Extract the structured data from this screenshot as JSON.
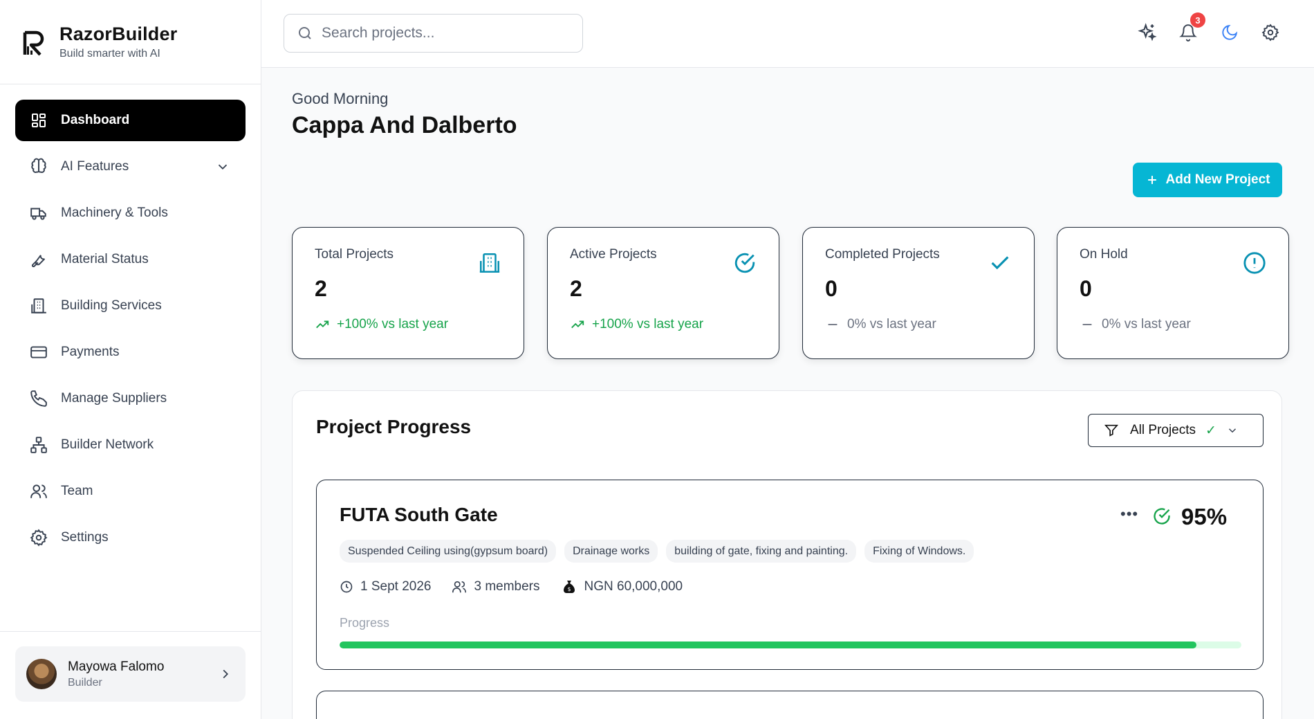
{
  "brand": {
    "name": "RazorBuilder",
    "tagline": "Build smarter with AI"
  },
  "sidebar": {
    "items": [
      {
        "label": "Dashboard",
        "icon": "dashboard-icon",
        "active": true
      },
      {
        "label": "AI Features",
        "icon": "brain-icon",
        "has_submenu": true
      },
      {
        "label": "Machinery & Tools",
        "icon": "truck-icon"
      },
      {
        "label": "Material Status",
        "icon": "wrench-icon"
      },
      {
        "label": "Building Services",
        "icon": "building-icon"
      },
      {
        "label": "Payments",
        "icon": "credit-card-icon"
      },
      {
        "label": "Manage Suppliers",
        "icon": "phone-icon"
      },
      {
        "label": "Builder Network",
        "icon": "network-icon"
      },
      {
        "label": "Team",
        "icon": "users-icon"
      },
      {
        "label": "Settings",
        "icon": "gear-icon"
      }
    ],
    "user": {
      "name": "Mayowa Falomo",
      "role": "Builder"
    }
  },
  "topbar": {
    "search_placeholder": "Search projects...",
    "notification_count": "3"
  },
  "main": {
    "greeting": "Good Morning",
    "company": "Cappa And Dalberto",
    "add_button": "Add New Project",
    "stats": [
      {
        "label": "Total Projects",
        "value": "2",
        "change": "+100% vs last year",
        "trend": "up",
        "icon": "building-icon"
      },
      {
        "label": "Active Projects",
        "value": "2",
        "change": "+100% vs last year",
        "trend": "up",
        "icon": "check-circle-icon"
      },
      {
        "label": "Completed Projects",
        "value": "0",
        "change": "0% vs last year",
        "trend": "flat",
        "icon": "check-icon"
      },
      {
        "label": "On Hold",
        "value": "0",
        "change": "0% vs last year",
        "trend": "flat",
        "icon": "alert-circle-icon"
      }
    ],
    "progress": {
      "title": "Project Progress",
      "filter_label": "All Projects",
      "projects": [
        {
          "name": "FUTA South Gate",
          "percent_label": "95%",
          "percent": 95,
          "tags": [
            "Suspended Ceiling using(gypsum board)",
            "Drainage works",
            "building of gate, fixing and painting.",
            "Fixing of Windows."
          ],
          "date": "1 Sept 2026",
          "members": "3 members",
          "budget": "NGN 60,000,000",
          "progress_label": "Progress"
        }
      ]
    }
  },
  "colors": {
    "accent": "#06b6d4",
    "success": "#16a34a",
    "progress": "#22c55e",
    "alert": "#ef4444"
  }
}
